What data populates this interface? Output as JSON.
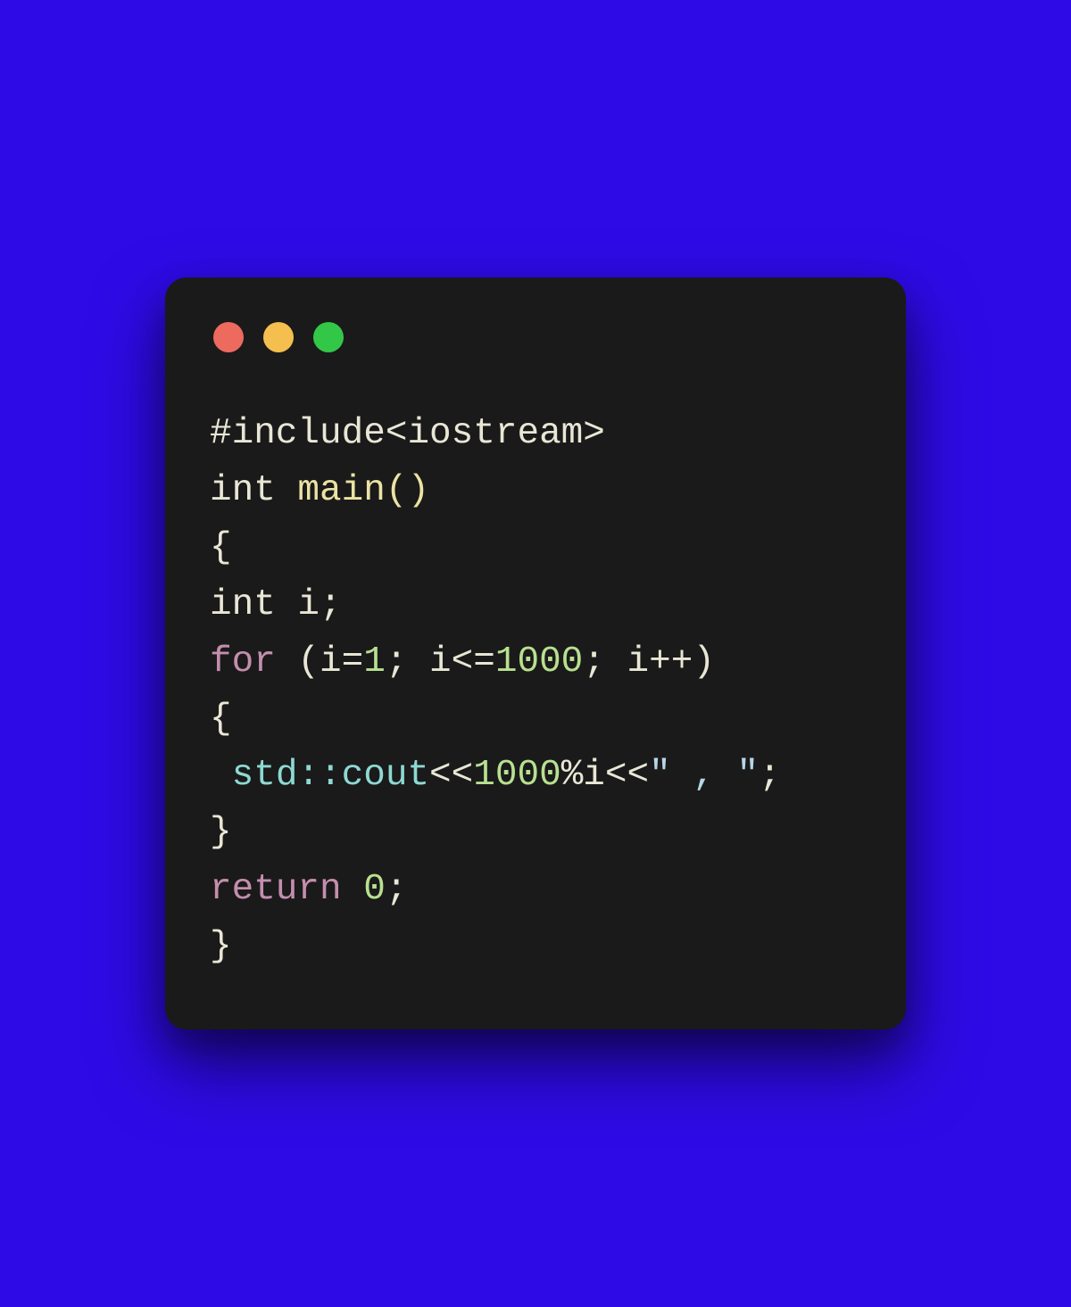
{
  "colors": {
    "background_gradient_start": "#3a1bdb",
    "background_gradient_end": "#2e0be6",
    "terminal_bg": "#1a1a1a",
    "traffic_red": "#ed6a5e",
    "traffic_yellow": "#f5bf4f",
    "traffic_green": "#33c748",
    "text_default": "#e8e6d5",
    "text_keyword": "#c48ead",
    "text_function": "#ebe3a3",
    "text_number": "#b8e090",
    "text_string": "#b7d5e6",
    "text_namespace": "#8ed9d2"
  },
  "code": {
    "tokens": [
      {
        "t": "#include",
        "c": "tok-default"
      },
      {
        "t": "<iostream>",
        "c": "tok-default"
      },
      {
        "t": "\n",
        "c": "tok-default"
      },
      {
        "t": "int",
        "c": "tok-keyword-type"
      },
      {
        "t": " ",
        "c": "tok-default"
      },
      {
        "t": "main",
        "c": "tok-function"
      },
      {
        "t": "(",
        "c": "tok-function"
      },
      {
        "t": ")",
        "c": "tok-function"
      },
      {
        "t": "\n",
        "c": "tok-default"
      },
      {
        "t": "{",
        "c": "tok-punctuation"
      },
      {
        "t": "\n",
        "c": "tok-default"
      },
      {
        "t": "int",
        "c": "tok-keyword-type"
      },
      {
        "t": " i;",
        "c": "tok-default"
      },
      {
        "t": "\n",
        "c": "tok-default"
      },
      {
        "t": "for",
        "c": "tok-keyword"
      },
      {
        "t": " (i=",
        "c": "tok-default"
      },
      {
        "t": "1",
        "c": "tok-number"
      },
      {
        "t": "; i<=",
        "c": "tok-default"
      },
      {
        "t": "1000",
        "c": "tok-number"
      },
      {
        "t": "; i++)",
        "c": "tok-default"
      },
      {
        "t": "\n",
        "c": "tok-default"
      },
      {
        "t": "{",
        "c": "tok-punctuation"
      },
      {
        "t": "\n",
        "c": "tok-default"
      },
      {
        "t": " ",
        "c": "tok-default"
      },
      {
        "t": "std::cout",
        "c": "tok-namespace"
      },
      {
        "t": "<<",
        "c": "tok-default"
      },
      {
        "t": "1000",
        "c": "tok-number"
      },
      {
        "t": "%i<<",
        "c": "tok-default"
      },
      {
        "t": "\" , \"",
        "c": "tok-string"
      },
      {
        "t": ";",
        "c": "tok-default"
      },
      {
        "t": "\n",
        "c": "tok-default"
      },
      {
        "t": "}",
        "c": "tok-punctuation"
      },
      {
        "t": "\n",
        "c": "tok-default"
      },
      {
        "t": "return",
        "c": "tok-keyword"
      },
      {
        "t": " ",
        "c": "tok-default"
      },
      {
        "t": "0",
        "c": "tok-number"
      },
      {
        "t": ";",
        "c": "tok-default"
      },
      {
        "t": "\n",
        "c": "tok-default"
      },
      {
        "t": "}",
        "c": "tok-punctuation"
      }
    ]
  }
}
